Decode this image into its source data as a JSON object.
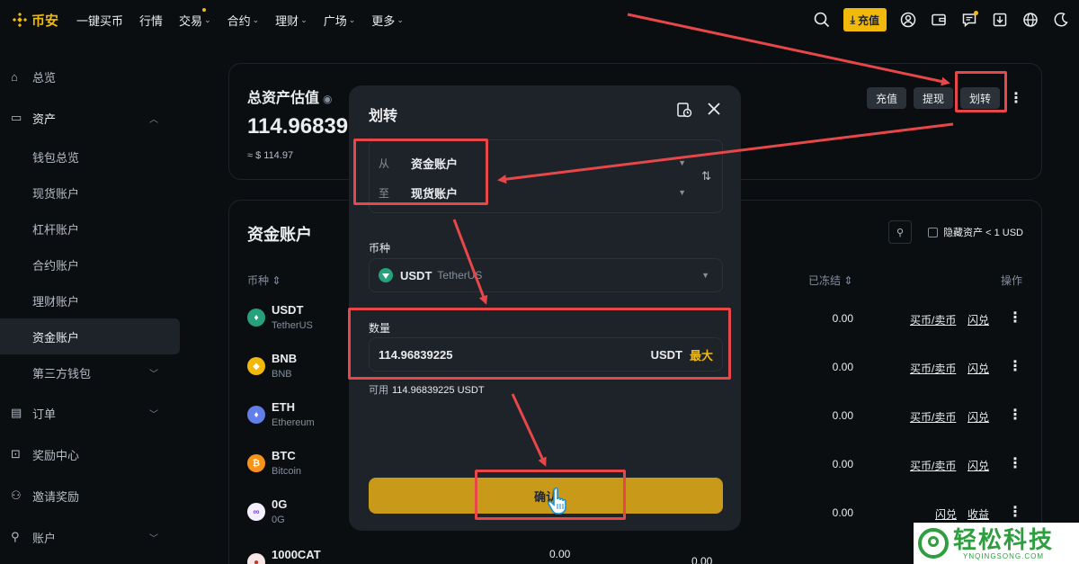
{
  "app": {
    "brand": "币安",
    "accent": "#f0b90b"
  },
  "topnav": {
    "items": [
      {
        "label": "一键买币",
        "caret": false,
        "dot": false
      },
      {
        "label": "行情",
        "caret": false,
        "dot": false
      },
      {
        "label": "交易",
        "caret": true,
        "dot": true
      },
      {
        "label": "合约",
        "caret": true,
        "dot": false
      },
      {
        "label": "理财",
        "caret": true,
        "dot": false
      },
      {
        "label": "广场",
        "caret": true,
        "dot": false
      },
      {
        "label": "更多",
        "caret": true,
        "dot": false
      }
    ],
    "deposit_label": "充值",
    "icons": [
      "search-icon",
      "user-icon",
      "wallet-icon",
      "message-icon",
      "download-icon",
      "globe-icon",
      "moon-icon"
    ]
  },
  "sidebar": {
    "overview": "总览",
    "assets": "资产",
    "asset_items": [
      "钱包总览",
      "现货账户",
      "杠杆账户",
      "合约账户",
      "理财账户",
      "资金账户",
      "第三方钱包"
    ],
    "active_item": "资金账户",
    "orders": "订单",
    "rewards": "奖励中心",
    "referral": "邀请奖励",
    "account": "账户"
  },
  "estimate": {
    "title": "总资产估值",
    "value": "114.96839",
    "usd": "≈ $ 114.97",
    "deposit": "充值",
    "withdraw": "提现",
    "transfer": "划转"
  },
  "funding": {
    "title": "资金账户",
    "hide_small": "隐藏资产 < 1 USD",
    "col_coin": "币种 ⇕",
    "col_frozen": "已冻结 ⇕",
    "col_action": "操作",
    "rows": [
      {
        "symbol": "USDT",
        "name": "TetherUS",
        "frozen": "0.00",
        "a1": "买币/卖币",
        "a2": "闪兑",
        "color": "#26a17b",
        "glyph": "♦"
      },
      {
        "symbol": "BNB",
        "name": "BNB",
        "frozen": "0.00",
        "a1": "买币/卖币",
        "a2": "闪兑",
        "color": "#f0b90b",
        "glyph": "◆"
      },
      {
        "symbol": "ETH",
        "name": "Ethereum",
        "frozen": "0.00",
        "a1": "买币/卖币",
        "a2": "闪兑",
        "color": "#627eea",
        "glyph": "♦"
      },
      {
        "symbol": "BTC",
        "name": "Bitcoin",
        "frozen": "0.00",
        "a1": "买币/卖币",
        "a2": "闪兑",
        "color": "#f7931a",
        "glyph": "₿"
      },
      {
        "symbol": "0G",
        "name": "0G",
        "frozen": "0.00",
        "a1": "闪兑",
        "a2": "收益",
        "color": "#f5f0ff",
        "glyph": "∞"
      }
    ],
    "partial_row": {
      "symbol": "1000CAT",
      "v1": "0.00",
      "v2": "0.00"
    }
  },
  "modal": {
    "title": "划转",
    "from_label": "从",
    "from_value": "资金账户",
    "to_label": "至",
    "to_value": "现货账户",
    "coin_label": "币种",
    "coin_symbol": "USDT",
    "coin_name": "TetherUS",
    "amount_label": "数量",
    "amount_value": "114.96839225",
    "amount_unit": "USDT",
    "max_label": "最大",
    "available_label": "可用",
    "available_value": "114.96839225 USDT",
    "confirm_label": "确认"
  },
  "watermark": {
    "main": "轻松科技",
    "sub": "YNQINGSONG.COM"
  }
}
